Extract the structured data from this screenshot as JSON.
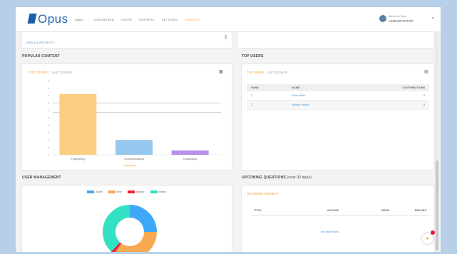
{
  "header": {
    "logo_text": "Opus",
    "logo_sub": "insights",
    "nav": [
      "DASHBOARD",
      "USERS",
      "REPORTS",
      "SETTINGS",
      "INSIGHTS"
    ],
    "user_line1": "Welcome, Bob",
    "user_line2": "ADMINISTRATOR"
  },
  "links": {
    "view_all_projects": "VIEW ALL PROJECTS"
  },
  "popular_content": {
    "section_title": "POPULAR CONTENT",
    "card_title": "TOP CONTENT",
    "card_sub": "LAST 30 DAYS",
    "chart_data": {
      "type": "bar",
      "categories": [
        "Engineering",
        "Communications",
        "Leadership"
      ],
      "values": [
        82,
        20,
        6
      ],
      "xlabel": "Category",
      "ylabel": "",
      "colors": [
        "#fbcf82",
        "#96c8ef",
        "#b892ea"
      ],
      "reference_lines": [
        70,
        57
      ]
    }
  },
  "top_users": {
    "section_title": "TOP USERS",
    "card_title": "TOP USERS",
    "card_sub": "LAST 30 DAYS",
    "columns": [
      "RANK",
      "NAME",
      "CONTRIBUTIONS"
    ],
    "rows": [
      {
        "rank": "1",
        "name": "Brian Miller",
        "count": "5"
      },
      {
        "rank": "2",
        "name": "Wendy Parker",
        "count": "4"
      }
    ]
  },
  "user_management": {
    "section_title": "USER MANAGEMENT",
    "legend": [
      {
        "label": "Active",
        "color": "#3da8f5"
      },
      {
        "label": "New",
        "color": "#f6a94f"
      },
      {
        "label": "Inactive",
        "color": "#e8213d"
      },
      {
        "label": "Invited",
        "color": "#32e0c4"
      }
    ],
    "donut": {
      "type": "pie",
      "values": [
        25,
        35,
        2,
        38
      ]
    }
  },
  "upcoming_questions": {
    "section_title": "UPCOMING QUESTIONS",
    "section_sub": "(next 30 days)",
    "card_title": "UPCOMING SURVEYS",
    "columns": [
      "TITLE",
      "AUTHOR",
      "VIEWS",
      "REPLIES"
    ],
    "empty_text": "No data found"
  },
  "fab_icon": "lightbulb-icon"
}
